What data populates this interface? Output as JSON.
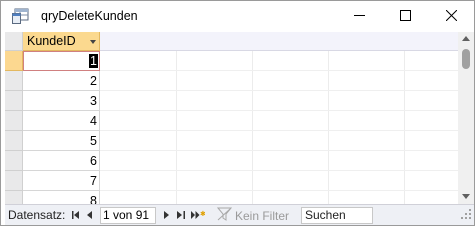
{
  "window": {
    "title": "qryDeleteKunden",
    "icon": "query-icon",
    "controls": [
      "minimize-icon",
      "maximize-icon",
      "close-icon"
    ]
  },
  "grid": {
    "column_header": "KundeID",
    "rows": [
      "1",
      "2",
      "3",
      "4",
      "5",
      "6",
      "7",
      "8"
    ],
    "current_row": 0
  },
  "navigation": {
    "label": "Datensatz:",
    "first_icon": "first-record-icon",
    "prev_icon": "previous-record-icon",
    "record_value": "1 von 91",
    "next_icon": "next-record-icon",
    "last_icon": "last-record-icon",
    "new_icon": "new-record-icon",
    "filter_label": "Kein Filter",
    "search_value": "Suchen"
  },
  "colors": {
    "header_accent": "#fbd98f",
    "active_cell_border": "#d08080"
  }
}
